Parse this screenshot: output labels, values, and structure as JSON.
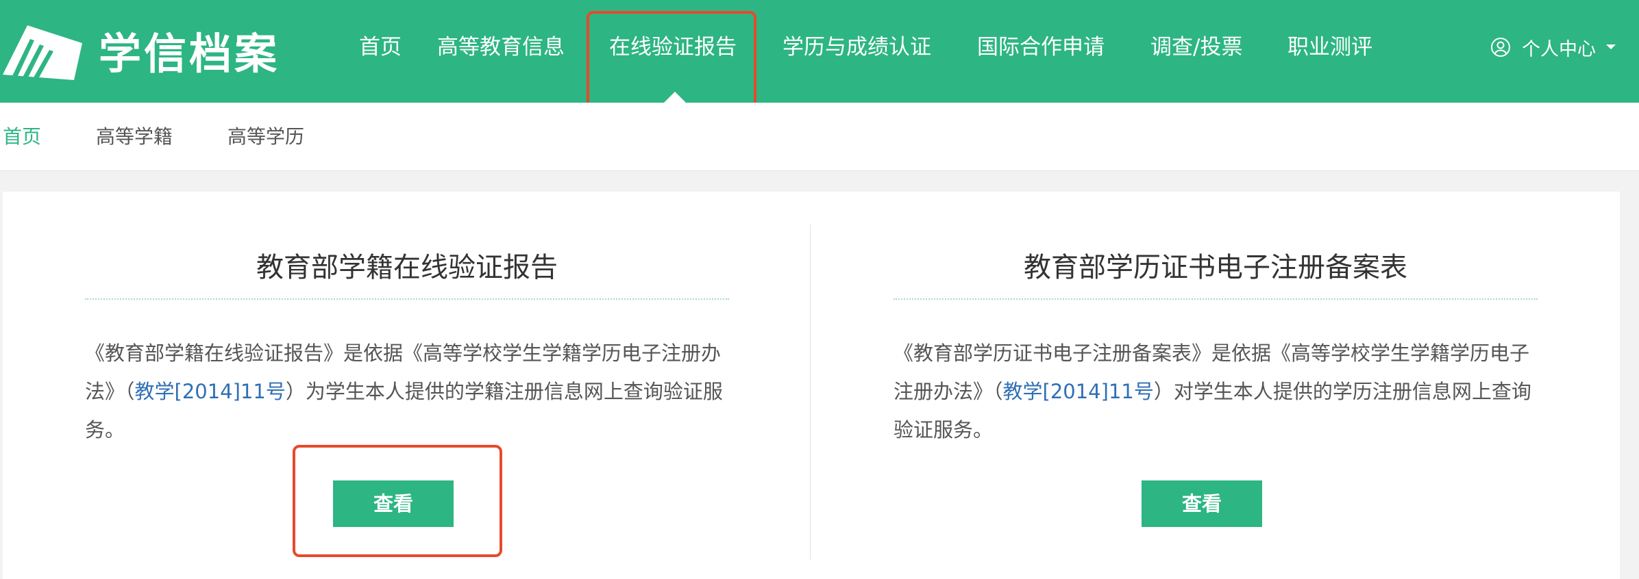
{
  "header": {
    "logo_text": "学信档案",
    "logo_icon": "book-pages-icon",
    "nav": [
      {
        "label": "首页"
      },
      {
        "label": "高等教育信息"
      },
      {
        "label": "在线验证报告"
      },
      {
        "label": "学历与成绩认证"
      },
      {
        "label": "国际合作申请"
      },
      {
        "label": "调查/投票"
      },
      {
        "label": "职业测评"
      }
    ],
    "active_nav": "在线验证报告",
    "user_center": {
      "label": "个人中心",
      "icon": "user-circle-icon",
      "caret": "caret-down-icon"
    }
  },
  "subnav": {
    "items": [
      {
        "label": "首页"
      },
      {
        "label": "高等学籍"
      },
      {
        "label": "高等学历"
      }
    ],
    "active": "首页"
  },
  "panels": [
    {
      "title": "教育部学籍在线验证报告",
      "desc_before": "《教育部学籍在线验证报告》是依据《高等学校学生学籍学历电子注册办法》（",
      "desc_link": "教学[2014]11号",
      "desc_after": "）为学生本人提供的学籍注册信息网上查询验证服务。",
      "button_label": "查看"
    },
    {
      "title": "教育部学历证书电子注册备案表",
      "desc_before": "《教育部学历证书电子注册备案表》是依据《高等学校学生学籍学历电子注册办法》（",
      "desc_link": "教学[2014]11号",
      "desc_after": "）对学生本人提供的学历注册信息网上查询验证服务。",
      "button_label": "查看"
    }
  ],
  "colors": {
    "brand_green": "#2db584",
    "link_blue": "#2f6fb5",
    "highlight_red": "#e8492b"
  }
}
